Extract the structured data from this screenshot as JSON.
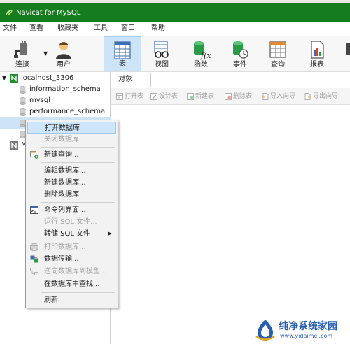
{
  "window": {
    "title": "Navicat for MySQL",
    "accent": "#157c1f"
  },
  "menu": [
    "文件",
    "查看",
    "收藏夹",
    "工具",
    "窗口",
    "帮助"
  ],
  "toolbar": {
    "connect": "连接",
    "user": "用户",
    "table": "表",
    "view": "视图",
    "function": "函数",
    "event": "事件",
    "query": "查询",
    "report": "报表"
  },
  "tree": {
    "connection": "localhost_3306",
    "databases": [
      "information_schema",
      "mysql",
      "performance_schema"
    ],
    "partial_m": "M"
  },
  "tab": {
    "objects": "对象"
  },
  "objbar": {
    "open_table": "打开表",
    "design_table": "设计表",
    "new_table": "新建表",
    "delete_table": "删除表",
    "import_wizard": "导入向导",
    "export_wizard": "导出向导"
  },
  "context_menu": {
    "open_db": "打开数据库",
    "close_db": "关闭数据库",
    "new_query": "新建查询...",
    "edit_db": "编辑数据库...",
    "new_db": "新建数据库...",
    "delete_db": "删除数据库",
    "console": "命令列界面...",
    "run_sql": "运行 SQL 文件...",
    "dump_sql": "转储 SQL 文件",
    "print_db": "打印数据库...",
    "data_transfer": "数据传输...",
    "reverse_model": "逆向数据库到模型...",
    "find_in_db": "在数据库中查找...",
    "refresh": "刷新"
  },
  "watermark": {
    "name": "纯净系统家园",
    "url": "www.yidaimei.com"
  }
}
